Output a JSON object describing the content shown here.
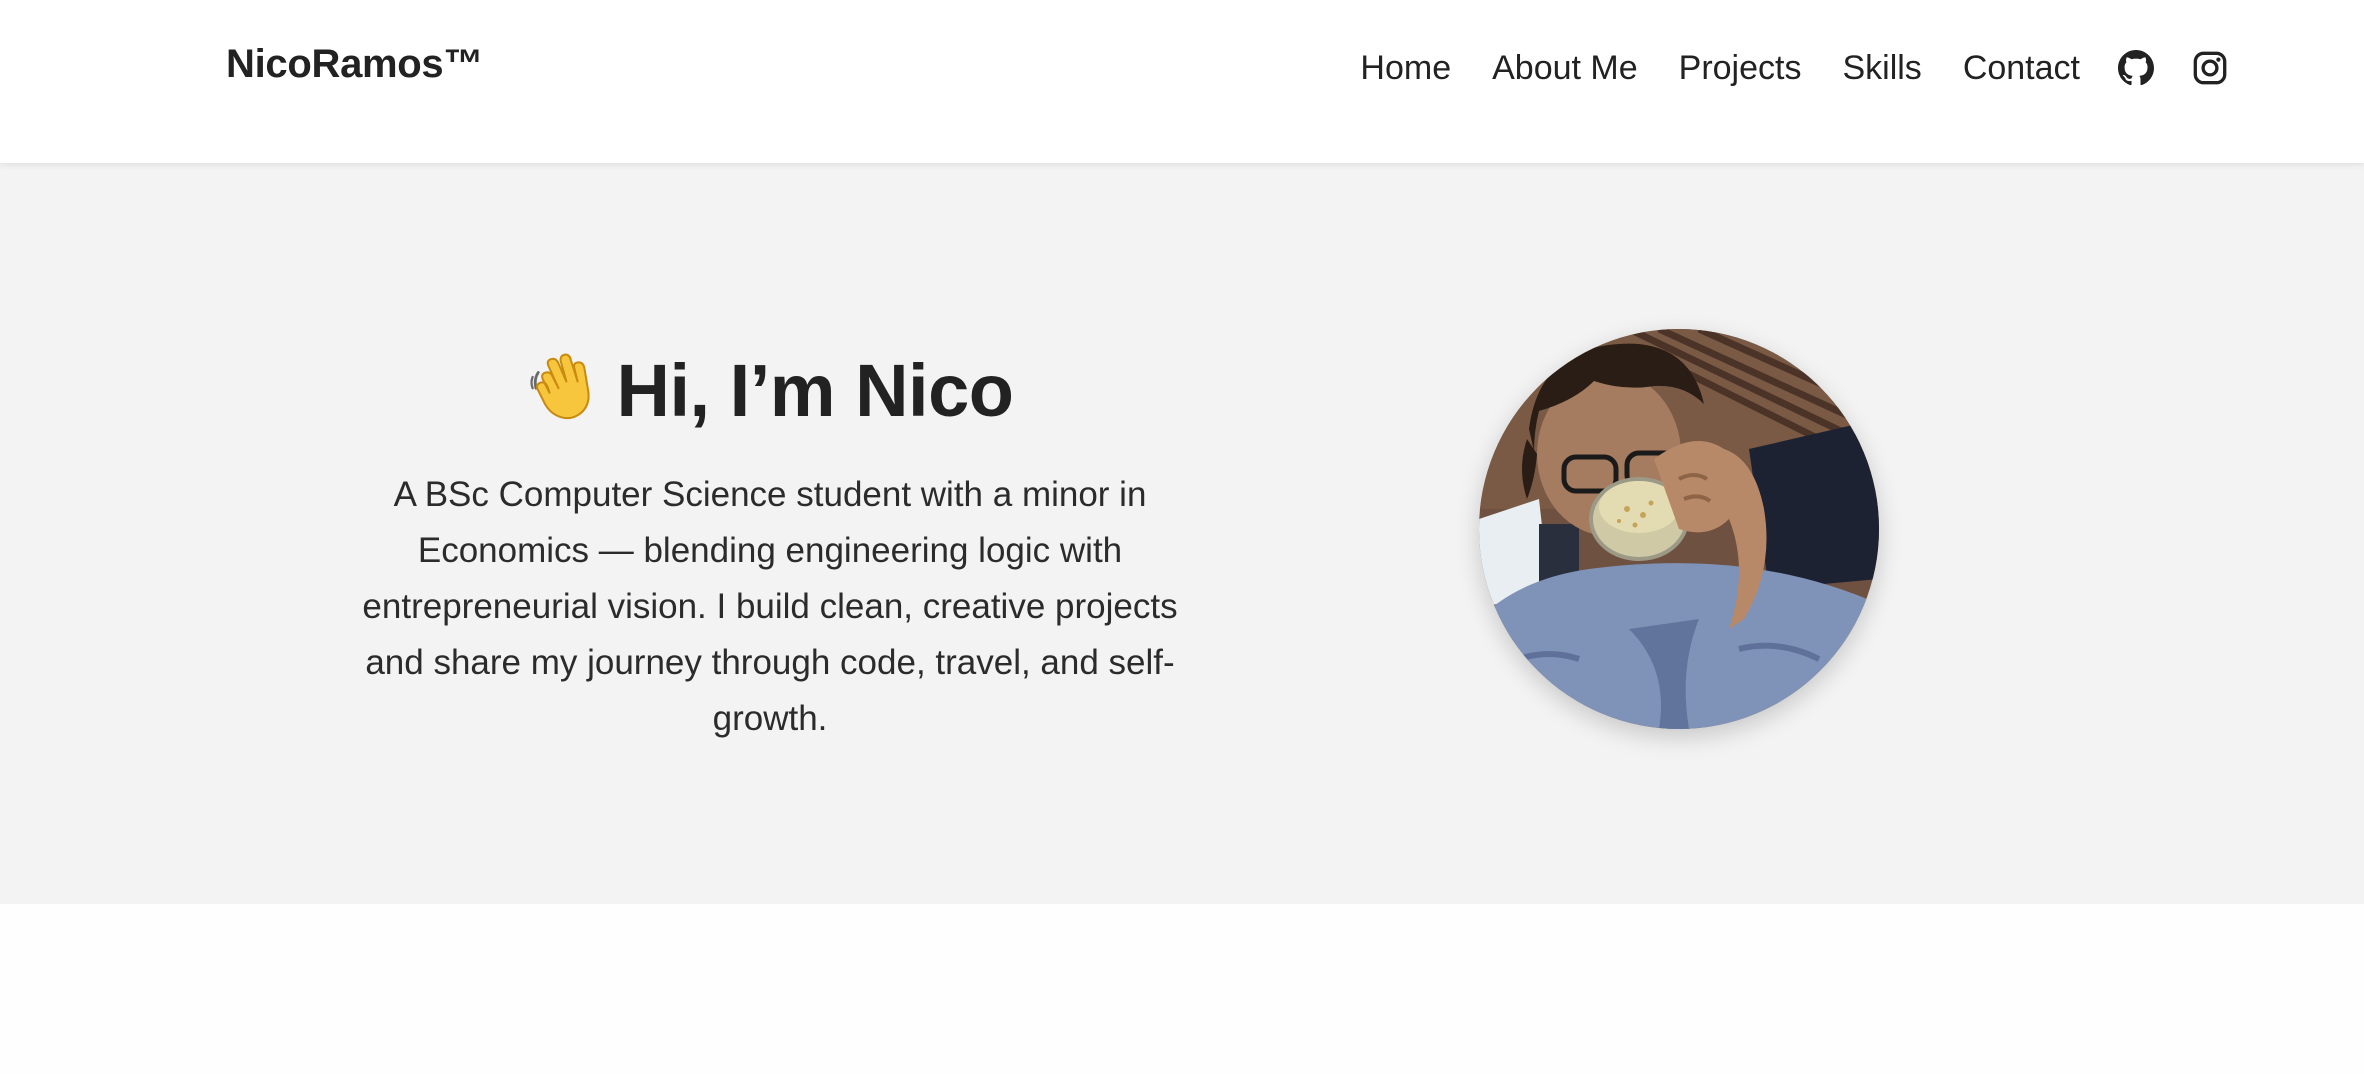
{
  "header": {
    "brand": "NicoRamos™",
    "nav_items": [
      "Home",
      "About Me",
      "Projects",
      "Skills",
      "Contact"
    ],
    "icons": [
      "github-icon",
      "instagram-icon"
    ]
  },
  "hero": {
    "emoji": "waving-hand-emoji",
    "title": "Hi, I’m Nico",
    "description": "A BSc Computer Science student with a minor in Economics — blending engineering logic with entrepreneurial vision. I build clean, creative projects and share my journey through code, travel, and self-growth.",
    "avatar": "profile-photo"
  },
  "colors": {
    "text": "#222222",
    "hero_background": "#f3f3f3",
    "navbar_background": "#ffffff"
  }
}
